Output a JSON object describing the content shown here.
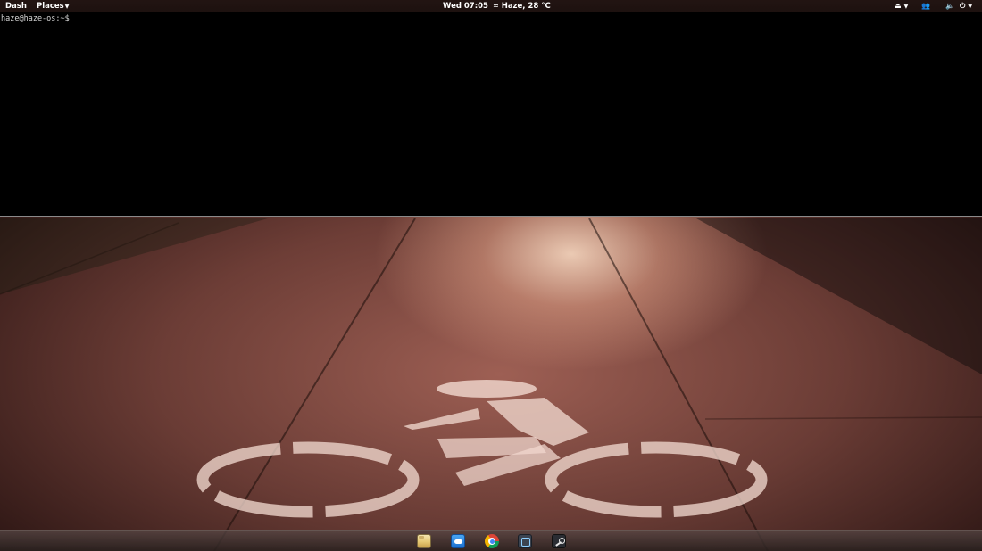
{
  "top_panel": {
    "dash_label": "Dash",
    "places_label": "Places",
    "clock": "Wed 07:05",
    "weather": "Haze, 28 °C",
    "icons": {
      "places_dropdown": "chevron-down-icon",
      "weather": "haze-icon",
      "eject": "eject-icon",
      "chat": "chat-icon",
      "volume": "volume-icon",
      "power": "power-icon"
    }
  },
  "terminal": {
    "prompt": "haze@haze-os:~$"
  },
  "dock": {
    "items": [
      {
        "icon": "files-icon"
      },
      {
        "icon": "mail-icon"
      },
      {
        "icon": "chrome-icon"
      },
      {
        "icon": "screenshot-icon"
      },
      {
        "icon": "steam-icon"
      }
    ]
  },
  "colors": {
    "terminal_bg": "#000000",
    "panel_text": "#ffffff",
    "prompt_text": "#d6d6d6"
  }
}
